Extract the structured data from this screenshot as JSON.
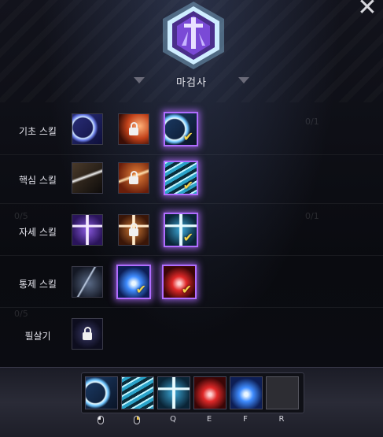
{
  "window": {
    "class_name": "마검사",
    "close_label": "✕"
  },
  "ghost_counters": {
    "left_a": "0/5",
    "right_a": "0/1",
    "left_b": "0/5",
    "right_b": "0/1"
  },
  "rows": [
    {
      "label": "기초 스킬",
      "skills": [
        {
          "icon": "crescent-wave-icon",
          "state": "available"
        },
        {
          "icon": "fire-orb-locked-icon",
          "state": "locked"
        },
        {
          "icon": "bright-wave-icon",
          "state": "selected"
        }
      ]
    },
    {
      "label": "핵심 스킬",
      "skills": [
        {
          "icon": "sword-slash-icon",
          "state": "available"
        },
        {
          "icon": "flame-slash-locked-icon",
          "state": "locked"
        },
        {
          "icon": "light-streak-icon",
          "state": "selected"
        }
      ]
    },
    {
      "label": "자세 스킬",
      "skills": [
        {
          "icon": "purple-sword-cross-icon",
          "state": "available"
        },
        {
          "icon": "orange-sword-cross-locked-icon",
          "state": "locked"
        },
        {
          "icon": "blue-sword-cross-icon",
          "state": "selected"
        }
      ]
    },
    {
      "label": "통제 스킬",
      "skills": [
        {
          "icon": "figure-strike-icon",
          "state": "available"
        },
        {
          "icon": "blue-burst-icon",
          "state": "selected"
        },
        {
          "icon": "red-burst-icon",
          "state": "selected"
        }
      ]
    },
    {
      "label": "필살기",
      "skills": [
        {
          "icon": "dark-ultimate-locked-icon",
          "state": "locked"
        }
      ]
    }
  ],
  "hotbar": {
    "slots": [
      {
        "icon": "bright-wave-icon",
        "key": "",
        "mouse": "left"
      },
      {
        "icon": "light-streak-icon",
        "key": "",
        "mouse": "right"
      },
      {
        "icon": "blue-sword-cross-icon",
        "key": "Q"
      },
      {
        "icon": "red-burst-icon",
        "key": "E"
      },
      {
        "icon": "blue-burst-icon",
        "key": "F"
      },
      {
        "icon": "empty-slot",
        "key": "R"
      }
    ]
  },
  "colors": {
    "selected_border": "#b06cff",
    "check": "#f3d34a",
    "emblem": "#7a4ad6"
  }
}
